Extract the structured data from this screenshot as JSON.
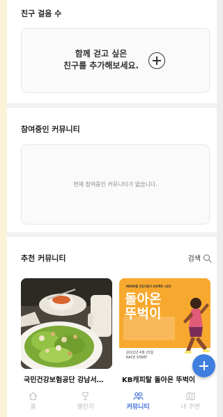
{
  "friends": {
    "title": "친구 걸음 수",
    "invite_line1": "함께 걷고 싶은",
    "invite_line2": "친구를 추가해보세요."
  },
  "joined": {
    "title": "참여중인 커뮤니티",
    "empty_message": "현재 참여중인 커뮤니티가 없습니다."
  },
  "recommended": {
    "title": "추천 커뮤니티",
    "search_label": "검색",
    "items": [
      {
        "label": "국민건강보험공단 강남서…"
      },
      {
        "label": "KB캐피탈 돌아온 뚜벅이",
        "poster_header": "KB캐피탈 건강지킴이 프로젝트 시즌2",
        "poster_title_1": "돌아온",
        "poster_title_2": "뚜벅이",
        "poster_date": "2022년 4월 25일",
        "poster_sub": "RACE START"
      }
    ]
  },
  "tabbar": {
    "items": [
      {
        "label": "홈",
        "icon": "home-icon",
        "active": false
      },
      {
        "label": "챌린지",
        "icon": "trophy-icon",
        "active": false
      },
      {
        "label": "커뮤니티",
        "icon": "community-icon",
        "active": true
      },
      {
        "label": "내 주변",
        "icon": "map-icon",
        "active": false
      }
    ]
  },
  "colors": {
    "accent": "#3f6fd8",
    "fab": "#3f7fe0",
    "poster_bg": "#f7a82e"
  }
}
